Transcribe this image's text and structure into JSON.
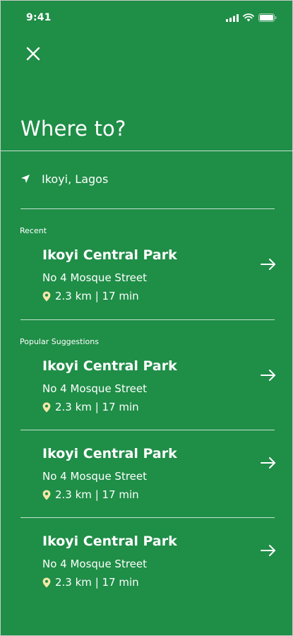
{
  "status_bar": {
    "time": "9:41"
  },
  "header": {
    "title": "Where to?"
  },
  "current_location": {
    "text": "Ikoyi, Lagos"
  },
  "recent": {
    "label": "Recent",
    "items": [
      {
        "name": "Ikoyi Central Park",
        "address": "No 4 Mosque Street",
        "meta": "2.3 km | 17 min"
      }
    ]
  },
  "popular": {
    "label": "Popular Suggestions",
    "items": [
      {
        "name": "Ikoyi Central Park",
        "address": "No 4 Mosque Street",
        "meta": "2.3 km | 17 min"
      },
      {
        "name": "Ikoyi Central Park",
        "address": "No 4 Mosque Street",
        "meta": "2.3 km | 17 min"
      },
      {
        "name": "Ikoyi Central Park",
        "address": "No 4 Mosque Street",
        "meta": "2.3 km | 17 min"
      }
    ]
  },
  "icons": {
    "close": "close-icon",
    "location": "navigation-arrow-icon",
    "pin": "map-pin-icon",
    "arrow": "arrow-right-icon"
  },
  "colors": {
    "background": "#1f8e47",
    "text": "#ffffff",
    "pin": "#f3e7a8"
  }
}
